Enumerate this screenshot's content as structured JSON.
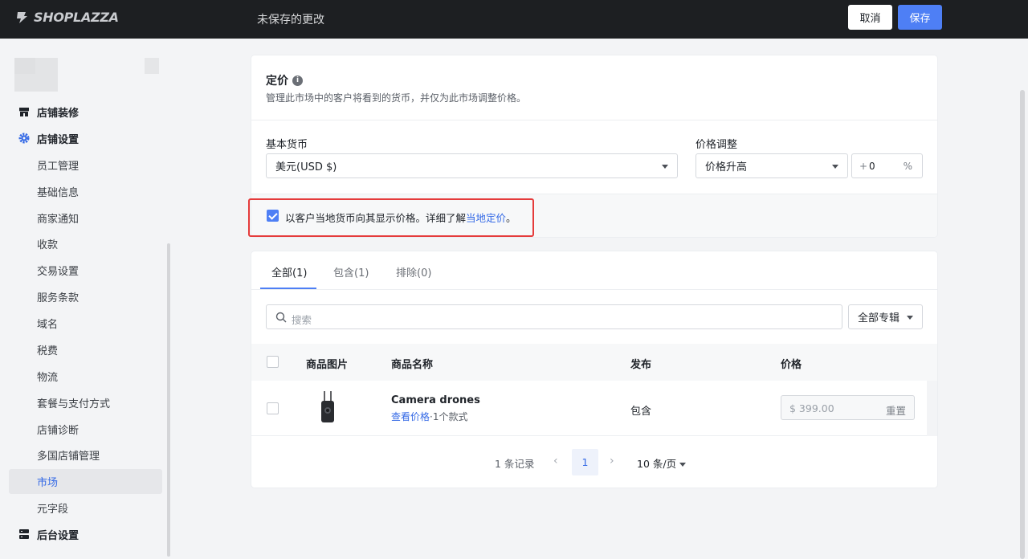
{
  "topbar": {
    "logo_text": "SHOPLAZZA",
    "unsaved_label": "未保存的更改",
    "cancel_label": "取消",
    "save_label": "保存"
  },
  "sidebar": {
    "items": [
      {
        "label": "店铺装修",
        "icon": "store-icon"
      },
      {
        "label": "店铺设置",
        "icon": "gear-icon"
      },
      {
        "label": "员工管理"
      },
      {
        "label": "基础信息"
      },
      {
        "label": "商家通知"
      },
      {
        "label": "收款"
      },
      {
        "label": "交易设置"
      },
      {
        "label": "服务条款"
      },
      {
        "label": "域名"
      },
      {
        "label": "税费"
      },
      {
        "label": "物流"
      },
      {
        "label": "套餐与支付方式"
      },
      {
        "label": "店铺诊断"
      },
      {
        "label": "多国店铺管理"
      },
      {
        "label": "市场",
        "active": true
      },
      {
        "label": "元字段"
      },
      {
        "label": "后台设置",
        "icon": "server-icon"
      }
    ]
  },
  "pricing": {
    "title": "定价",
    "description": "管理此市场中的客户将看到的货币，并仅为此市场调整价格。",
    "base_currency_label": "基本货币",
    "base_currency_value": "美元(USD $)",
    "price_adjust_label": "价格调整",
    "price_adjust_value": "价格升高",
    "adjust_prefix": "+",
    "adjust_value": "0",
    "adjust_suffix": "%",
    "local_currency_text": "以客户当地货币向其显示价格。详细了解",
    "local_currency_link": "当地定价",
    "local_currency_end": "。",
    "local_currency_checked": true
  },
  "products": {
    "tabs": [
      {
        "label": "全部(1)",
        "active": true
      },
      {
        "label": "包含(1)"
      },
      {
        "label": "排除(0)"
      }
    ],
    "search_placeholder": "搜索",
    "collection_filter": "全部专辑",
    "columns": [
      "商品图片",
      "商品名称",
      "发布",
      "价格"
    ],
    "rows": [
      {
        "name": "Camera drones",
        "view_price_link": "查看价格",
        "variants": "·1个款式",
        "published": "包含",
        "price_placeholder": "$ 399.00",
        "reset_label": "重置"
      }
    ]
  },
  "pagination": {
    "total": "1 条记录",
    "current_page": "1",
    "page_size": "10 条/页"
  },
  "colors": {
    "accent": "#4e7ff5",
    "highlight": "#e53b3b",
    "topbar": "#1d1f22"
  }
}
